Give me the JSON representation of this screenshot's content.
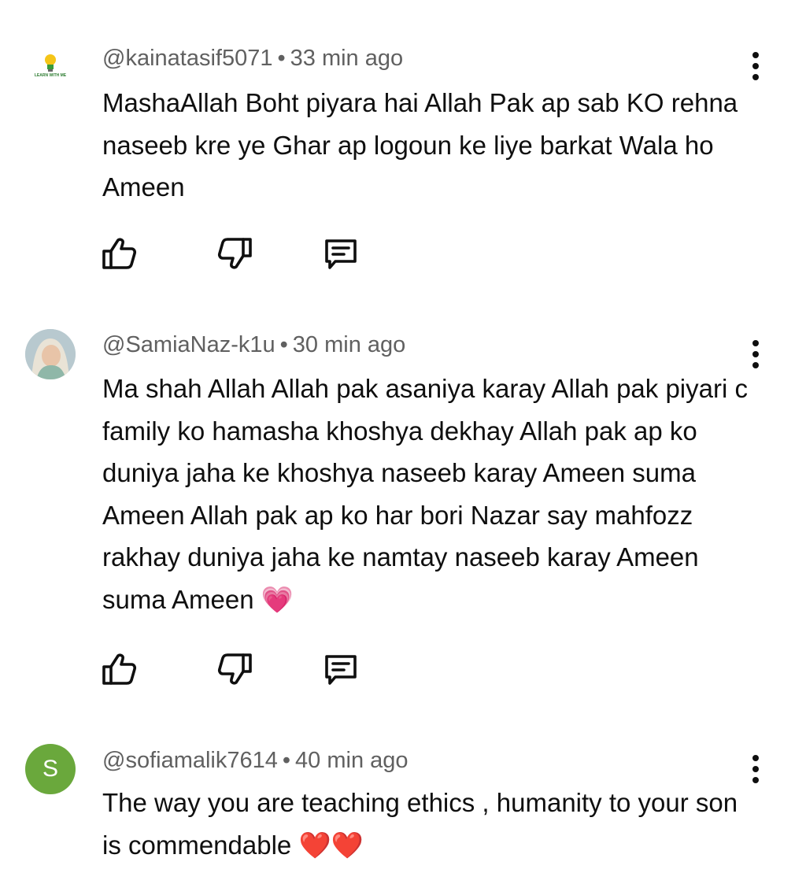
{
  "comments": [
    {
      "avatar": {
        "type": "logo",
        "icon": "lightbulb-icon",
        "text": "LEARN WITH ME"
      },
      "author": "@kainatasif5071",
      "time": "33 min ago",
      "text": "MashaAllah Boht piyara hai Allah Pak ap sab KO rehna naseeb kre ye Ghar ap logoun ke liye barkat Wala ho Ameen"
    },
    {
      "avatar": {
        "type": "photo"
      },
      "author": "@SamiaNaz-k1u",
      "time": "30 min ago",
      "text": "Ma shah Allah Allah pak asaniya karay Allah pak piyari c family ko hamasha khoshya dekhay Allah pak ap ko duniya jaha ke khoshya naseeb karay Ameen suma Ameen Allah pak ap ko har bori Nazar say mahfozz rakhay duniya jaha ke namtay naseeb karay Ameen suma Ameen",
      "emoji": "💗"
    },
    {
      "avatar": {
        "type": "letter",
        "letter": "S",
        "color": "#6aa83c"
      },
      "author": "@sofiamalik7614",
      "time": "40 min ago",
      "text": "The way you are teaching ethics , humanity to your son is commendable",
      "emoji": "❤️❤️"
    }
  ],
  "separator": "•",
  "icons": [
    "like-icon",
    "dislike-icon",
    "reply-icon",
    "more-options-icon"
  ]
}
